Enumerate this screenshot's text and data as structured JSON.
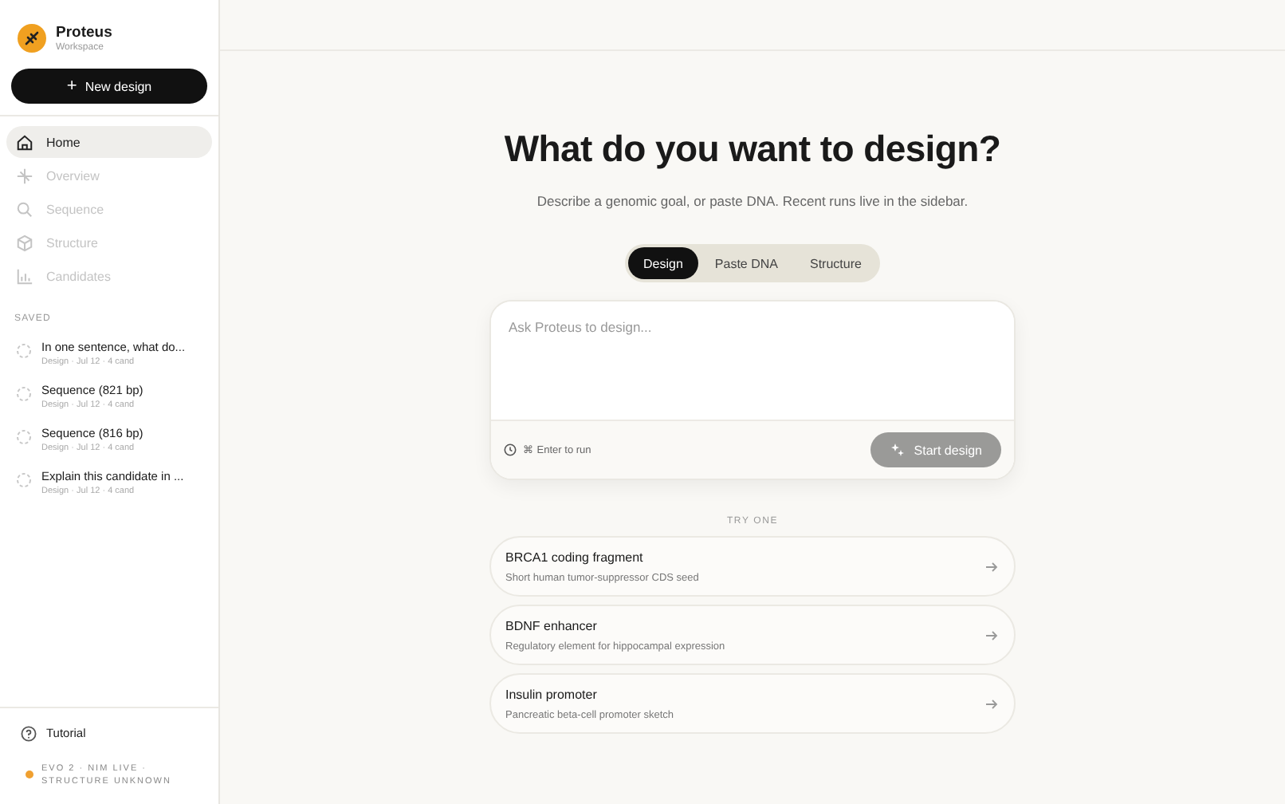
{
  "workspace": {
    "name": "Proteus",
    "subtitle": "Workspace"
  },
  "new_button": {
    "icon": "+",
    "label": "New design"
  },
  "nav": [
    {
      "label": "Home",
      "selected": true,
      "disabled": false
    },
    {
      "label": "Overview",
      "selected": false,
      "disabled": true
    },
    {
      "label": "Sequence",
      "selected": false,
      "disabled": true
    },
    {
      "label": "Structure",
      "selected": false,
      "disabled": true
    },
    {
      "label": "Candidates",
      "selected": false,
      "disabled": true
    }
  ],
  "saved": {
    "heading": "SAVED",
    "items": [
      {
        "title": "In one sentence, what do...",
        "meta": "Design · Jul 12 · 4 cand"
      },
      {
        "title": "Sequence (821 bp)",
        "meta": "Design · Jul 12 · 4 cand"
      },
      {
        "title": "Sequence (816 bp)",
        "meta": "Design · Jul 12 · 4 cand"
      },
      {
        "title": "Explain this candidate in ...",
        "meta": "Design · Jul 12 · 4 cand"
      }
    ]
  },
  "tutorial": "Tutorial",
  "status": {
    "text": "EVO 2 · NIM LIVE · STRUCTURE UNKNOWN",
    "color": "#f0a030"
  },
  "heading": "What do you want to design?",
  "subheading": "Describe a genomic goal, or paste DNA. Recent runs live in the sidebar.",
  "modes": [
    {
      "label": "Design",
      "selected": true
    },
    {
      "label": "Paste DNA",
      "selected": false
    },
    {
      "label": "Structure",
      "selected": false
    }
  ],
  "prompt": {
    "placeholder": "Ask Proteus to design...",
    "hint": "⌘ Enter to run",
    "submit": "Start design",
    "disabled": true
  },
  "try_heading": "TRY ONE",
  "suggestions": [
    {
      "title": "BRCA1 coding fragment",
      "description": "Short human tumor-suppressor CDS seed"
    },
    {
      "title": "BDNF enhancer",
      "description": "Regulatory element for hippocampal expression"
    },
    {
      "title": "Insulin promoter",
      "description": "Pancreatic beta-cell promoter sketch"
    }
  ]
}
